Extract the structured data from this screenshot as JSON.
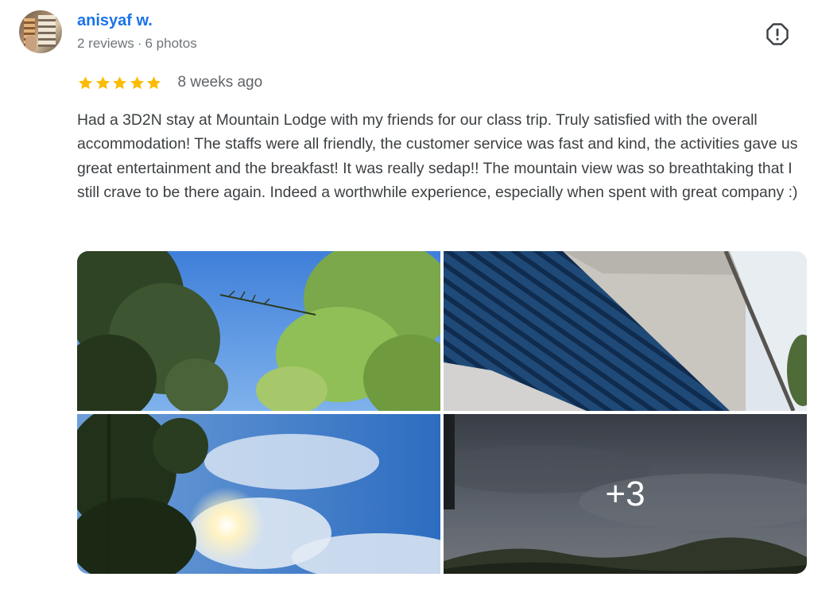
{
  "review": {
    "author": {
      "name": "anisyaf w.",
      "reviews": "2 reviews",
      "separator": "·",
      "photos": "6 photos"
    },
    "rating": 5,
    "rating_max": 5,
    "time": "8 weeks ago",
    "text": "Had a 3D2N stay at Mountain Lodge with my friends for our class trip. Truly satisfied with the overall accommodation! The staffs were all friendly, the customer service was fast and kind, the activities gave us great entertainment and the breakfast! It was really sedap!! The mountain view was so breathtaking that I still crave to be there again. Indeed a worthwhile experience, especially when spent with great company :)",
    "more_photos_label": "+3"
  },
  "colors": {
    "author_link": "#1a73e8",
    "star": "#fbbc04",
    "meta_text": "#70757a",
    "body_text": "#3c4043"
  },
  "icons": {
    "report": "report-icon",
    "star": "star-icon"
  }
}
